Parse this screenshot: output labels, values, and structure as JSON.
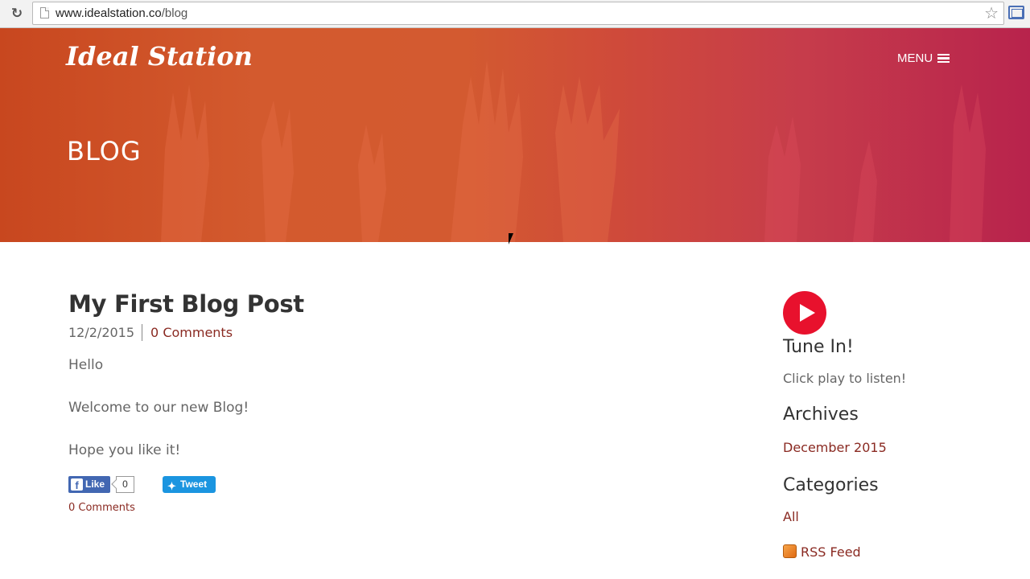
{
  "browser": {
    "url_host": "www.idealstation.co",
    "url_path": "/blog"
  },
  "header": {
    "logo": "Ideal Station",
    "menu_label": "MENU",
    "page_title": "BLOG"
  },
  "post": {
    "title": "My First Blog Post",
    "date": "12/2/2015",
    "comments_link": "0 Comments",
    "paragraphs": [
      "Hello",
      "Welcome to our new Blog!",
      "Hope you like it!"
    ],
    "like_label": "Like",
    "like_count": "0",
    "tweet_label": "Tweet",
    "comments_footer": "0 Comments"
  },
  "sidebar": {
    "tune_heading": "Tune In!",
    "tune_text": "Click play to listen!",
    "archives_heading": "Archives",
    "archives_item": "December 2015",
    "categories_heading": "Categories",
    "categories_item": "All",
    "rss_label": "RSS Feed"
  },
  "colors": {
    "accent_link": "#8a2a22",
    "play_red": "#e8112d",
    "facebook": "#4267b2",
    "twitter": "#1b95e0"
  }
}
